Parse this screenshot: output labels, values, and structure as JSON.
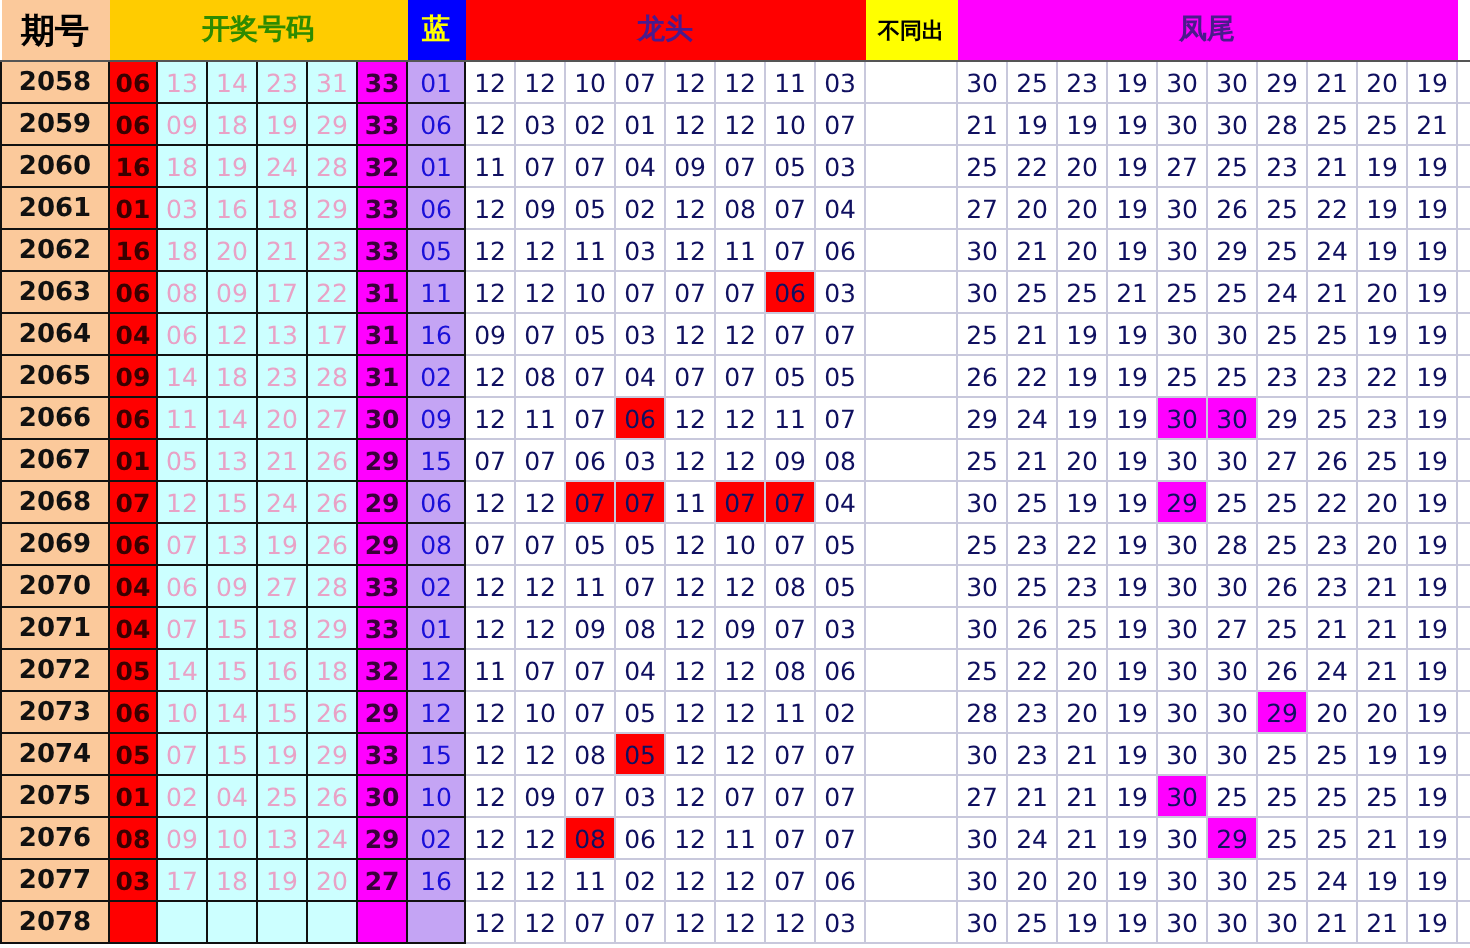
{
  "headers": {
    "period": "期号",
    "draw": "开奖号码",
    "blue": "蓝",
    "dragon": "龙头",
    "distinct": "不同出",
    "tail": "凤尾"
  },
  "rows": [
    {
      "period": "2058",
      "draw": [
        "06",
        "13",
        "14",
        "23",
        "31",
        "33"
      ],
      "blue": "01",
      "dragon": [
        "12",
        "12",
        "10",
        "07",
        "12",
        "12",
        "11",
        "03"
      ],
      "dragon_hit": [
        false,
        false,
        false,
        false,
        false,
        false,
        false,
        false
      ],
      "tail": [
        "30",
        "25",
        "23",
        "19",
        "30",
        "30",
        "29",
        "21",
        "20",
        "19"
      ],
      "tail_hit": [
        false,
        false,
        false,
        false,
        false,
        false,
        false,
        false,
        false,
        false
      ]
    },
    {
      "period": "2059",
      "draw": [
        "06",
        "09",
        "18",
        "19",
        "29",
        "33"
      ],
      "blue": "06",
      "dragon": [
        "12",
        "03",
        "02",
        "01",
        "12",
        "12",
        "10",
        "07"
      ],
      "dragon_hit": [
        false,
        false,
        false,
        false,
        false,
        false,
        false,
        false
      ],
      "tail": [
        "21",
        "19",
        "19",
        "19",
        "30",
        "30",
        "28",
        "25",
        "25",
        "21"
      ],
      "tail_hit": [
        false,
        false,
        false,
        false,
        false,
        false,
        false,
        false,
        false,
        false
      ]
    },
    {
      "period": "2060",
      "draw": [
        "16",
        "18",
        "19",
        "24",
        "28",
        "32"
      ],
      "blue": "01",
      "dragon": [
        "11",
        "07",
        "07",
        "04",
        "09",
        "07",
        "05",
        "03"
      ],
      "dragon_hit": [
        false,
        false,
        false,
        false,
        false,
        false,
        false,
        false
      ],
      "tail": [
        "25",
        "22",
        "20",
        "19",
        "27",
        "25",
        "23",
        "21",
        "19",
        "19"
      ],
      "tail_hit": [
        false,
        false,
        false,
        false,
        false,
        false,
        false,
        false,
        false,
        false
      ]
    },
    {
      "period": "2061",
      "draw": [
        "01",
        "03",
        "16",
        "18",
        "29",
        "33"
      ],
      "blue": "06",
      "dragon": [
        "12",
        "09",
        "05",
        "02",
        "12",
        "08",
        "07",
        "04"
      ],
      "dragon_hit": [
        false,
        false,
        false,
        false,
        false,
        false,
        false,
        false
      ],
      "tail": [
        "27",
        "20",
        "20",
        "19",
        "30",
        "26",
        "25",
        "22",
        "19",
        "19"
      ],
      "tail_hit": [
        false,
        false,
        false,
        false,
        false,
        false,
        false,
        false,
        false,
        false
      ]
    },
    {
      "period": "2062",
      "draw": [
        "16",
        "18",
        "20",
        "21",
        "23",
        "33"
      ],
      "blue": "05",
      "dragon": [
        "12",
        "12",
        "11",
        "03",
        "12",
        "11",
        "07",
        "06"
      ],
      "dragon_hit": [
        false,
        false,
        false,
        false,
        false,
        false,
        false,
        false
      ],
      "tail": [
        "30",
        "21",
        "20",
        "19",
        "30",
        "29",
        "25",
        "24",
        "19",
        "19"
      ],
      "tail_hit": [
        false,
        false,
        false,
        false,
        false,
        false,
        false,
        false,
        false,
        false
      ]
    },
    {
      "period": "2063",
      "draw": [
        "06",
        "08",
        "09",
        "17",
        "22",
        "31"
      ],
      "blue": "11",
      "dragon": [
        "12",
        "12",
        "10",
        "07",
        "07",
        "07",
        "06",
        "03"
      ],
      "dragon_hit": [
        false,
        false,
        false,
        false,
        false,
        false,
        true,
        false
      ],
      "tail": [
        "30",
        "25",
        "25",
        "21",
        "25",
        "25",
        "24",
        "21",
        "20",
        "19"
      ],
      "tail_hit": [
        false,
        false,
        false,
        false,
        false,
        false,
        false,
        false,
        false,
        false
      ]
    },
    {
      "period": "2064",
      "draw": [
        "04",
        "06",
        "12",
        "13",
        "17",
        "31"
      ],
      "blue": "16",
      "dragon": [
        "09",
        "07",
        "05",
        "03",
        "12",
        "12",
        "07",
        "07"
      ],
      "dragon_hit": [
        false,
        false,
        false,
        false,
        false,
        false,
        false,
        false
      ],
      "tail": [
        "25",
        "21",
        "19",
        "19",
        "30",
        "30",
        "25",
        "25",
        "19",
        "19"
      ],
      "tail_hit": [
        false,
        false,
        false,
        false,
        false,
        false,
        false,
        false,
        false,
        false
      ]
    },
    {
      "period": "2065",
      "draw": [
        "09",
        "14",
        "18",
        "23",
        "28",
        "31"
      ],
      "blue": "02",
      "dragon": [
        "12",
        "08",
        "07",
        "04",
        "07",
        "07",
        "05",
        "05"
      ],
      "dragon_hit": [
        false,
        false,
        false,
        false,
        false,
        false,
        false,
        false
      ],
      "tail": [
        "26",
        "22",
        "19",
        "19",
        "25",
        "25",
        "23",
        "23",
        "22",
        "19"
      ],
      "tail_hit": [
        false,
        false,
        false,
        false,
        false,
        false,
        false,
        false,
        false,
        false
      ]
    },
    {
      "period": "2066",
      "draw": [
        "06",
        "11",
        "14",
        "20",
        "27",
        "30"
      ],
      "blue": "09",
      "dragon": [
        "12",
        "11",
        "07",
        "06",
        "12",
        "12",
        "11",
        "07"
      ],
      "dragon_hit": [
        false,
        false,
        false,
        true,
        false,
        false,
        false,
        false
      ],
      "tail": [
        "29",
        "24",
        "19",
        "19",
        "30",
        "30",
        "29",
        "25",
        "23",
        "19"
      ],
      "tail_hit": [
        false,
        false,
        false,
        false,
        true,
        true,
        false,
        false,
        false,
        false
      ]
    },
    {
      "period": "2067",
      "draw": [
        "01",
        "05",
        "13",
        "21",
        "26",
        "29"
      ],
      "blue": "15",
      "dragon": [
        "07",
        "07",
        "06",
        "03",
        "12",
        "12",
        "09",
        "08"
      ],
      "dragon_hit": [
        false,
        false,
        false,
        false,
        false,
        false,
        false,
        false
      ],
      "tail": [
        "25",
        "21",
        "20",
        "19",
        "30",
        "30",
        "27",
        "26",
        "25",
        "19"
      ],
      "tail_hit": [
        false,
        false,
        false,
        false,
        false,
        false,
        false,
        false,
        false,
        false
      ]
    },
    {
      "period": "2068",
      "draw": [
        "07",
        "12",
        "15",
        "24",
        "26",
        "29"
      ],
      "blue": "06",
      "dragon": [
        "12",
        "12",
        "07",
        "07",
        "11",
        "07",
        "07",
        "04"
      ],
      "dragon_hit": [
        false,
        false,
        true,
        true,
        false,
        true,
        true,
        false
      ],
      "tail": [
        "30",
        "25",
        "19",
        "19",
        "29",
        "25",
        "25",
        "22",
        "20",
        "19"
      ],
      "tail_hit": [
        false,
        false,
        false,
        false,
        true,
        false,
        false,
        false,
        false,
        false
      ]
    },
    {
      "period": "2069",
      "draw": [
        "06",
        "07",
        "13",
        "19",
        "26",
        "29"
      ],
      "blue": "08",
      "dragon": [
        "07",
        "07",
        "05",
        "05",
        "12",
        "10",
        "07",
        "05"
      ],
      "dragon_hit": [
        false,
        false,
        false,
        false,
        false,
        false,
        false,
        false
      ],
      "tail": [
        "25",
        "23",
        "22",
        "19",
        "30",
        "28",
        "25",
        "23",
        "20",
        "19"
      ],
      "tail_hit": [
        false,
        false,
        false,
        false,
        false,
        false,
        false,
        false,
        false,
        false
      ]
    },
    {
      "period": "2070",
      "draw": [
        "04",
        "06",
        "09",
        "27",
        "28",
        "33"
      ],
      "blue": "02",
      "dragon": [
        "12",
        "12",
        "11",
        "07",
        "12",
        "12",
        "08",
        "05"
      ],
      "dragon_hit": [
        false,
        false,
        false,
        false,
        false,
        false,
        false,
        false
      ],
      "tail": [
        "30",
        "25",
        "23",
        "19",
        "30",
        "30",
        "26",
        "23",
        "21",
        "19"
      ],
      "tail_hit": [
        false,
        false,
        false,
        false,
        false,
        false,
        false,
        false,
        false,
        false
      ]
    },
    {
      "period": "2071",
      "draw": [
        "04",
        "07",
        "15",
        "18",
        "29",
        "33"
      ],
      "blue": "01",
      "dragon": [
        "12",
        "12",
        "09",
        "08",
        "12",
        "09",
        "07",
        "03"
      ],
      "dragon_hit": [
        false,
        false,
        false,
        false,
        false,
        false,
        false,
        false
      ],
      "tail": [
        "30",
        "26",
        "25",
        "19",
        "30",
        "27",
        "25",
        "21",
        "21",
        "19"
      ],
      "tail_hit": [
        false,
        false,
        false,
        false,
        false,
        false,
        false,
        false,
        false,
        false
      ]
    },
    {
      "period": "2072",
      "draw": [
        "05",
        "14",
        "15",
        "16",
        "18",
        "32"
      ],
      "blue": "12",
      "dragon": [
        "11",
        "07",
        "07",
        "04",
        "12",
        "12",
        "08",
        "06"
      ],
      "dragon_hit": [
        false,
        false,
        false,
        false,
        false,
        false,
        false,
        false
      ],
      "tail": [
        "25",
        "22",
        "20",
        "19",
        "30",
        "30",
        "26",
        "24",
        "21",
        "19"
      ],
      "tail_hit": [
        false,
        false,
        false,
        false,
        false,
        false,
        false,
        false,
        false,
        false
      ]
    },
    {
      "period": "2073",
      "draw": [
        "06",
        "10",
        "14",
        "15",
        "26",
        "29"
      ],
      "blue": "12",
      "dragon": [
        "12",
        "10",
        "07",
        "05",
        "12",
        "12",
        "11",
        "02"
      ],
      "dragon_hit": [
        false,
        false,
        false,
        false,
        false,
        false,
        false,
        false
      ],
      "tail": [
        "28",
        "23",
        "20",
        "19",
        "30",
        "30",
        "29",
        "20",
        "20",
        "19"
      ],
      "tail_hit": [
        false,
        false,
        false,
        false,
        false,
        false,
        true,
        false,
        false,
        false
      ]
    },
    {
      "period": "2074",
      "draw": [
        "05",
        "07",
        "15",
        "19",
        "29",
        "33"
      ],
      "blue": "15",
      "dragon": [
        "12",
        "12",
        "08",
        "05",
        "12",
        "12",
        "07",
        "07"
      ],
      "dragon_hit": [
        false,
        false,
        false,
        true,
        false,
        false,
        false,
        false
      ],
      "tail": [
        "30",
        "23",
        "21",
        "19",
        "30",
        "30",
        "25",
        "25",
        "19",
        "19"
      ],
      "tail_hit": [
        false,
        false,
        false,
        false,
        false,
        false,
        false,
        false,
        false,
        false
      ]
    },
    {
      "period": "2075",
      "draw": [
        "01",
        "02",
        "04",
        "25",
        "26",
        "30"
      ],
      "blue": "10",
      "dragon": [
        "12",
        "09",
        "07",
        "03",
        "12",
        "07",
        "07",
        "07"
      ],
      "dragon_hit": [
        false,
        false,
        false,
        false,
        false,
        false,
        false,
        false
      ],
      "tail": [
        "27",
        "21",
        "21",
        "19",
        "30",
        "25",
        "25",
        "25",
        "25",
        "19"
      ],
      "tail_hit": [
        false,
        false,
        false,
        false,
        true,
        false,
        false,
        false,
        false,
        false
      ]
    },
    {
      "period": "2076",
      "draw": [
        "08",
        "09",
        "10",
        "13",
        "24",
        "29"
      ],
      "blue": "02",
      "dragon": [
        "12",
        "12",
        "08",
        "06",
        "12",
        "11",
        "07",
        "07"
      ],
      "dragon_hit": [
        false,
        false,
        true,
        false,
        false,
        false,
        false,
        false
      ],
      "tail": [
        "30",
        "24",
        "21",
        "19",
        "30",
        "29",
        "25",
        "25",
        "21",
        "19"
      ],
      "tail_hit": [
        false,
        false,
        false,
        false,
        false,
        true,
        false,
        false,
        false,
        false
      ]
    },
    {
      "period": "2077",
      "draw": [
        "03",
        "17",
        "18",
        "19",
        "20",
        "27"
      ],
      "blue": "16",
      "dragon": [
        "12",
        "12",
        "11",
        "02",
        "12",
        "12",
        "07",
        "06"
      ],
      "dragon_hit": [
        false,
        false,
        false,
        false,
        false,
        false,
        false,
        false
      ],
      "tail": [
        "30",
        "20",
        "20",
        "19",
        "30",
        "30",
        "25",
        "24",
        "19",
        "19"
      ],
      "tail_hit": [
        false,
        false,
        false,
        false,
        false,
        false,
        false,
        false,
        false,
        false
      ]
    },
    {
      "period": "2078",
      "dragon": [
        "12",
        "12",
        "07",
        "07",
        "12",
        "12",
        "12",
        "03"
      ],
      "dragon_hit": [
        false,
        false,
        false,
        false,
        false,
        false,
        false,
        false
      ],
      "tail": [
        "30",
        "25",
        "19",
        "19",
        "30",
        "30",
        "30",
        "21",
        "21",
        "19"
      ],
      "tail_hit": [
        false,
        false,
        false,
        false,
        false,
        false,
        false,
        false,
        false,
        false
      ]
    }
  ]
}
